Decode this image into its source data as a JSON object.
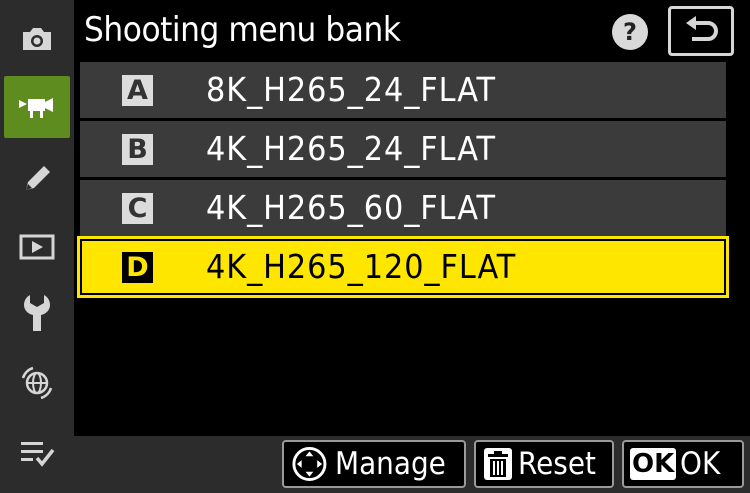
{
  "header": {
    "title": "Shooting menu bank",
    "help_label": "?"
  },
  "sidebar": {
    "items": [
      {
        "name": "photo-shooting-menu",
        "icon": "camera-icon",
        "active": false
      },
      {
        "name": "video-recording-menu",
        "icon": "video-camera-icon",
        "active": true
      },
      {
        "name": "custom-settings-menu",
        "icon": "pencil-icon",
        "active": false
      },
      {
        "name": "playback-menu",
        "icon": "playback-icon",
        "active": false
      },
      {
        "name": "setup-menu",
        "icon": "wrench-icon",
        "active": false
      },
      {
        "name": "network-menu",
        "icon": "network-globe-icon",
        "active": false
      },
      {
        "name": "my-menu",
        "icon": "list-check-icon",
        "active": false
      }
    ]
  },
  "banks": [
    {
      "letter": "A",
      "label": "8K_H265_24_FLAT",
      "selected": false
    },
    {
      "letter": "B",
      "label": "4K_H265_24_FLAT",
      "selected": false
    },
    {
      "letter": "C",
      "label": "4K_H265_60_FLAT",
      "selected": false
    },
    {
      "letter": "D",
      "label": "4K_H265_120_FLAT",
      "selected": true
    }
  ],
  "footer": {
    "manage_label": "Manage",
    "reset_label": "Reset",
    "ok_badge": "OK",
    "ok_label": "OK"
  },
  "colors": {
    "selection_yellow": "#ffe600",
    "active_tab_green": "#5f8c1e",
    "panel_gray": "#2c2c2c",
    "row_gray": "#3b3b3b"
  }
}
